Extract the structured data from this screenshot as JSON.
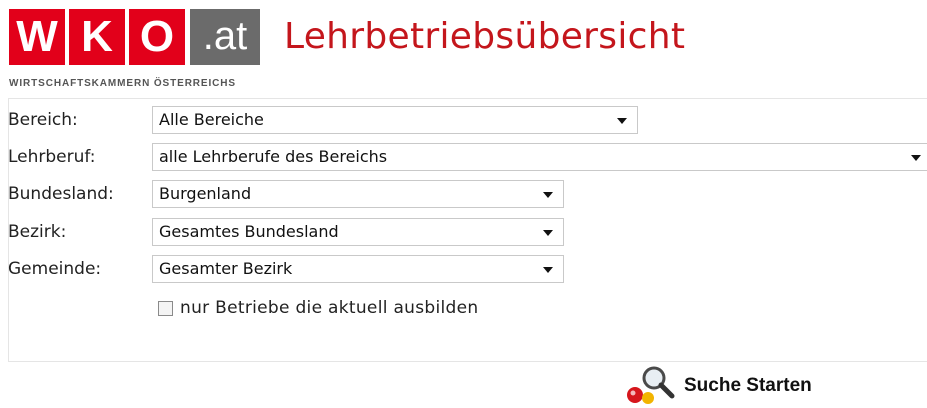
{
  "header": {
    "logo_letters": [
      "W",
      "K",
      "O"
    ],
    "logo_suffix": ".at",
    "page_title": "Lehrbetriebsübersicht",
    "subtitle": "WIRTSCHAFTSKAMMERN ÖSTERREICHS",
    "colors": {
      "brand_red": "#e2001a",
      "title_red": "#c4161c",
      "logo_grey": "#6b6b6b"
    }
  },
  "form": {
    "fields": [
      {
        "label": "Bereich:",
        "value": "Alle Bereiche"
      },
      {
        "label": "Lehrberuf:",
        "value": "alle Lehrberufe des Bereichs"
      },
      {
        "label": "Bundesland:",
        "value": "Burgenland"
      },
      {
        "label": "Bezirk:",
        "value": "Gesamtes Bundesland"
      },
      {
        "label": "Gemeinde:",
        "value": "Gesamter Bezirk"
      }
    ],
    "checkbox": {
      "label": "nur Betriebe die aktuell ausbilden",
      "checked": false
    }
  },
  "search": {
    "label": "Suche Starten",
    "icon": "magnifier-search-icon"
  }
}
